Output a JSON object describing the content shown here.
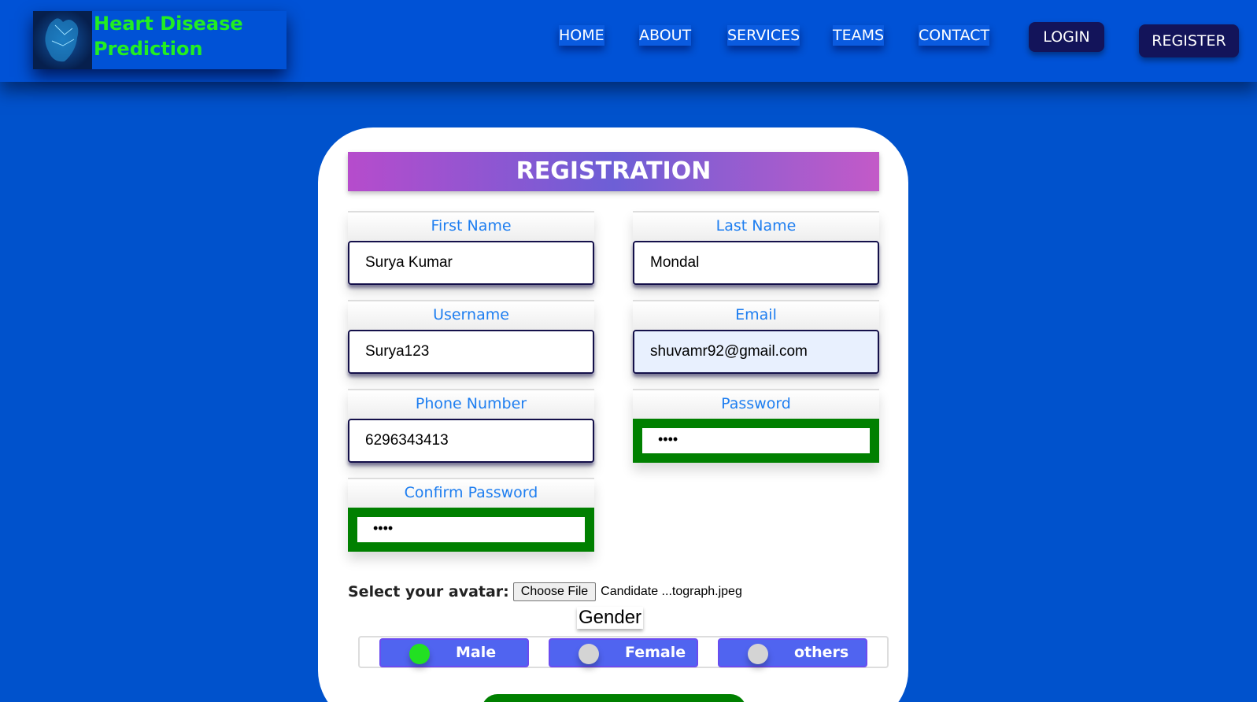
{
  "brand": {
    "line1": "Heart Disease",
    "line2": "Prediction"
  },
  "nav": {
    "items": [
      "HOME",
      "ABOUT",
      "SERVICES",
      "TEAMS",
      "CONTACT"
    ],
    "login": "LOGIN",
    "register": "REGISTER"
  },
  "form": {
    "title": "REGISTRATION",
    "first_name": {
      "label": "First Name",
      "value": "Surya Kumar"
    },
    "last_name": {
      "label": "Last Name",
      "value": "Mondal"
    },
    "username": {
      "label": "Username",
      "value": "Surya123"
    },
    "email": {
      "label": "Email",
      "value": "shuvamr92@gmail.com"
    },
    "phone": {
      "label": "Phone Number",
      "value": "6296343413"
    },
    "password": {
      "label": "Password",
      "value": "••••"
    },
    "confirm_password": {
      "label": "Confirm Password",
      "value": "••••"
    },
    "avatar": {
      "label": "Select your avatar:",
      "button": "Choose File",
      "file": "Candidate ...tograph.jpeg"
    },
    "gender": {
      "label": "Gender",
      "options": [
        "Male",
        "Female",
        "others"
      ],
      "selected": "Male"
    }
  },
  "colors": {
    "background": "#0052cc",
    "accent_green": "#008000",
    "brand_green": "#22ee22",
    "label_blue": "#1e7ef0"
  }
}
